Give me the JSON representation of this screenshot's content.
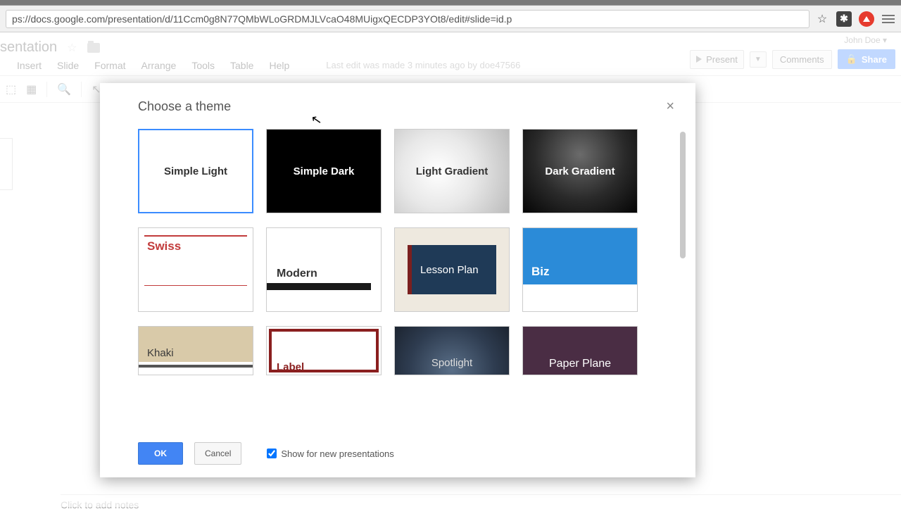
{
  "browser": {
    "url": "ps://docs.google.com/presentation/d/11Ccm0g8N77QMbWLoGRDMJLVcaO48MUigxQECDP3YOt8/edit#slide=id.p"
  },
  "user_name": "John Doe",
  "doc_title": "sentation",
  "buttons": {
    "present": "Present",
    "comments": "Comments",
    "share": "Share"
  },
  "menus": {
    "insert": "Insert",
    "slide": "Slide",
    "format": "Format",
    "arrange": "Arrange",
    "tools": "Tools",
    "table": "Table",
    "help": "Help"
  },
  "edit_info": "Last edit was made 3 minutes ago by doe47566",
  "notes_placeholder": "Click to add notes",
  "dialog": {
    "title": "Choose a theme",
    "close": "×",
    "ok": "OK",
    "cancel": "Cancel",
    "show_label": "Show for new presentations",
    "themes": {
      "simple_light": "Simple Light",
      "simple_dark": "Simple Dark",
      "light_gradient": "Light Gradient",
      "dark_gradient": "Dark Gradient",
      "swiss": "Swiss",
      "modern": "Modern",
      "lesson_plan": "Lesson Plan",
      "biz": "Biz",
      "khaki": "Khaki",
      "label": "Label",
      "spotlight": "Spotlight",
      "paper_plane": "Paper Plane"
    }
  }
}
